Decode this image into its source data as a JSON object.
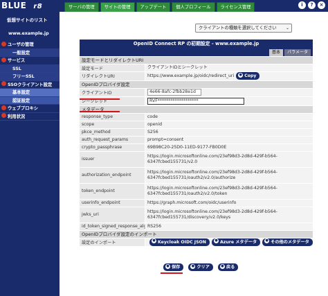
{
  "app": {
    "logo": "BLUE",
    "logo_suffix": "r8"
  },
  "tabs": [
    {
      "label": "サーバの管理",
      "active": false
    },
    {
      "label": "サイトの管理",
      "active": true
    },
    {
      "label": "アップデート",
      "active": false
    },
    {
      "label": "個人プロフィール",
      "active": false
    },
    {
      "label": "ライセンス管理",
      "active": false
    }
  ],
  "top_icons": [
    {
      "name": "info-icon",
      "glyph": "i"
    },
    {
      "name": "help-icon",
      "glyph": "?"
    },
    {
      "name": "logout-icon",
      "glyph": "×"
    }
  ],
  "sidebar": {
    "title": "仮想サイトのリスト",
    "host": "www.example.jp",
    "items": [
      {
        "label": "ユーザの管理",
        "bullet": true,
        "type": "top"
      },
      {
        "label": "一般設定",
        "bullet": false,
        "type": "sub"
      },
      {
        "label": "サービス",
        "bullet": true,
        "type": "top"
      },
      {
        "label": "SSL",
        "bullet": false,
        "type": "sub"
      },
      {
        "label": "フリーSSL",
        "bullet": false,
        "type": "sub"
      },
      {
        "label": "SSOクライアント設定",
        "bullet": true,
        "type": "top"
      },
      {
        "label": "基本設定",
        "bullet": false,
        "type": "active-sub"
      },
      {
        "label": "認証設定",
        "bullet": false,
        "type": "active-sub2"
      },
      {
        "label": "ウェブプロキシ",
        "bullet": true,
        "type": "top"
      },
      {
        "label": "利用状況",
        "bullet": true,
        "type": "top"
      }
    ]
  },
  "client_type_select": {
    "value": "クライアントの種類を選択してください",
    "arrow": "⌄"
  },
  "panel": {
    "title": "OpenID Connect RP の初期設定 - www.example.jp",
    "tab_basic": "基本",
    "tab_param": "パラメータ"
  },
  "sections": {
    "mode_redirect": "設定モードとリダイレクトURI",
    "provider_info": "OpenIDプロバイダ設定",
    "metadata": "メタデータ",
    "provider_import": "OpenIDプロバイダ設定のインポート"
  },
  "rows": {
    "mode": {
      "key": "設定モード",
      "value": "クライアントIDとシークレット"
    },
    "redirect_uri": {
      "key": "リダイレクトURI",
      "value": "https://www.example.jp/oidc/redirect_uri",
      "button": "Copy"
    },
    "client_id": {
      "key": "クライアントID",
      "value": "4e66-8afc-2fbb28e1d"
    },
    "secret": {
      "key": "シークレット",
      "value": "RVF*******************"
    },
    "response_type": {
      "key": "response_type",
      "value": "code"
    },
    "scope": {
      "key": "scope",
      "value": "openid"
    },
    "pkce_method": {
      "key": "pkce_method",
      "value": "S256"
    },
    "auth_request_params": {
      "key": "auth_request_params",
      "value": "prompt=consent"
    },
    "crypto_passphrase": {
      "key": "crypto_passphrase",
      "value": "69B98C20-25D0-11ED-9177-FB0D0E"
    },
    "issuer": {
      "key": "issuer",
      "value": "https://login.microsoftonline.com/23ef98d3-2d8d-429f-b564-6347fcbed155731/v2.0"
    },
    "authorization_endpoint": {
      "key": "authorization_endpoint",
      "value": "https://login.microsoftonline.com/23ef98d3-2d8d-429f-b564-6347fcbed155731/oauth2/v2.0/authorize"
    },
    "token_endpoint": {
      "key": "token_endpoint",
      "value": "https://login.microsoftonline.com/23ef98d3-2d8d-429f-b564-6347fcbed155731/oauth2/v2.0/token"
    },
    "userinfo_endpoint": {
      "key": "userinfo_endpoint",
      "value": "https://graph.microsoft.com/oidc/userinfo"
    },
    "jwks_uri": {
      "key": "jwks_uri",
      "value": "https://login.microsoftonline.com/23ef98d3-2d8d-429f-b564-6347fcbed155731/discovery/v2.0/keys"
    },
    "id_token_alg": {
      "key": "id_token_signed_response_alg",
      "value": "RS256"
    },
    "import": {
      "key": "設定のインポート"
    }
  },
  "import_buttons": [
    "Keycloak OIDC JSON",
    "Azure メタデータ",
    "その他のメタデータ"
  ],
  "bottom_buttons": [
    "保存",
    "クリア",
    "戻る"
  ],
  "colors": {
    "nav": "#1a2b6b",
    "tab_green": "#2f8a3c",
    "highlight_red": "#d4121b"
  }
}
